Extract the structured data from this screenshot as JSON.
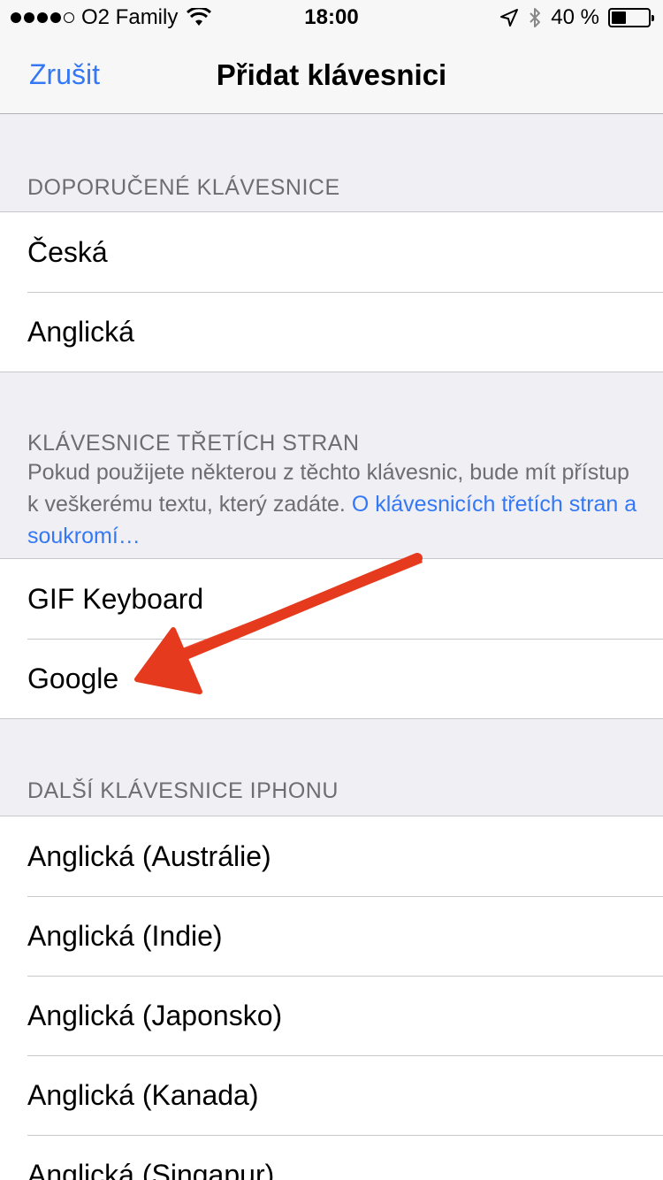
{
  "status_bar": {
    "carrier": "O2 Family",
    "time": "18:00",
    "battery_percent": "40 %",
    "battery_level": 0.4,
    "icons": [
      "signal-icon",
      "wifi-icon",
      "location-icon",
      "bluetooth-icon",
      "battery-icon"
    ]
  },
  "nav": {
    "cancel_label": "Zrušit",
    "title": "Přidat klávesnici"
  },
  "sections": {
    "suggested": {
      "header": "DOPORUČENÉ KLÁVESNICE",
      "items": [
        "Česká",
        "Anglická"
      ]
    },
    "third_party": {
      "header": "KLÁVESNICE TŘETÍCH STRAN",
      "description": "Pokud použijete některou z těchto klávesnic, bude mít přístup k veškerému textu, který zadáte. ",
      "link": "O klávesnicích třetích stran a soukromí…",
      "items": [
        "GIF Keyboard",
        "Google"
      ]
    },
    "other": {
      "header": "DALŠÍ KLÁVESNICE IPHONU",
      "items": [
        "Anglická (Austrálie)",
        "Anglická (Indie)",
        "Anglická (Japonsko)",
        "Anglická (Kanada)",
        "Anglická (Singapur)"
      ]
    }
  },
  "colors": {
    "accent": "#3478f6",
    "annotation_arrow": "#e63a1e",
    "background": "#efeff4"
  }
}
